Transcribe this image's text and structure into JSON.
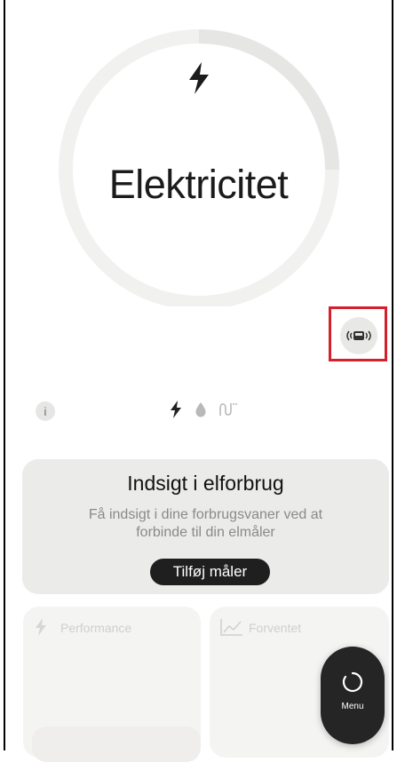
{
  "hero": {
    "title": "Elektricitet",
    "icon": "bolt-icon",
    "meter_button_icon": "meter-signal-icon"
  },
  "utility_tabs": [
    "bolt-icon",
    "water-drop-icon",
    "heat-icon"
  ],
  "info_button": {
    "label": "i"
  },
  "insight_card": {
    "title": "Indsigt i elforbrug",
    "text": "Få indsigt i dine forbrugsvaner ved at forbinde til din elmåler",
    "button_label": "Tilføj måler"
  },
  "tiles": {
    "performance_label": "Performance",
    "forecast_label": "Forventet"
  },
  "menu": {
    "label": "Menu"
  },
  "colors": {
    "highlight": "#d3202a",
    "card_bg": "#ebebea",
    "button_dark": "#1f1f1f"
  }
}
